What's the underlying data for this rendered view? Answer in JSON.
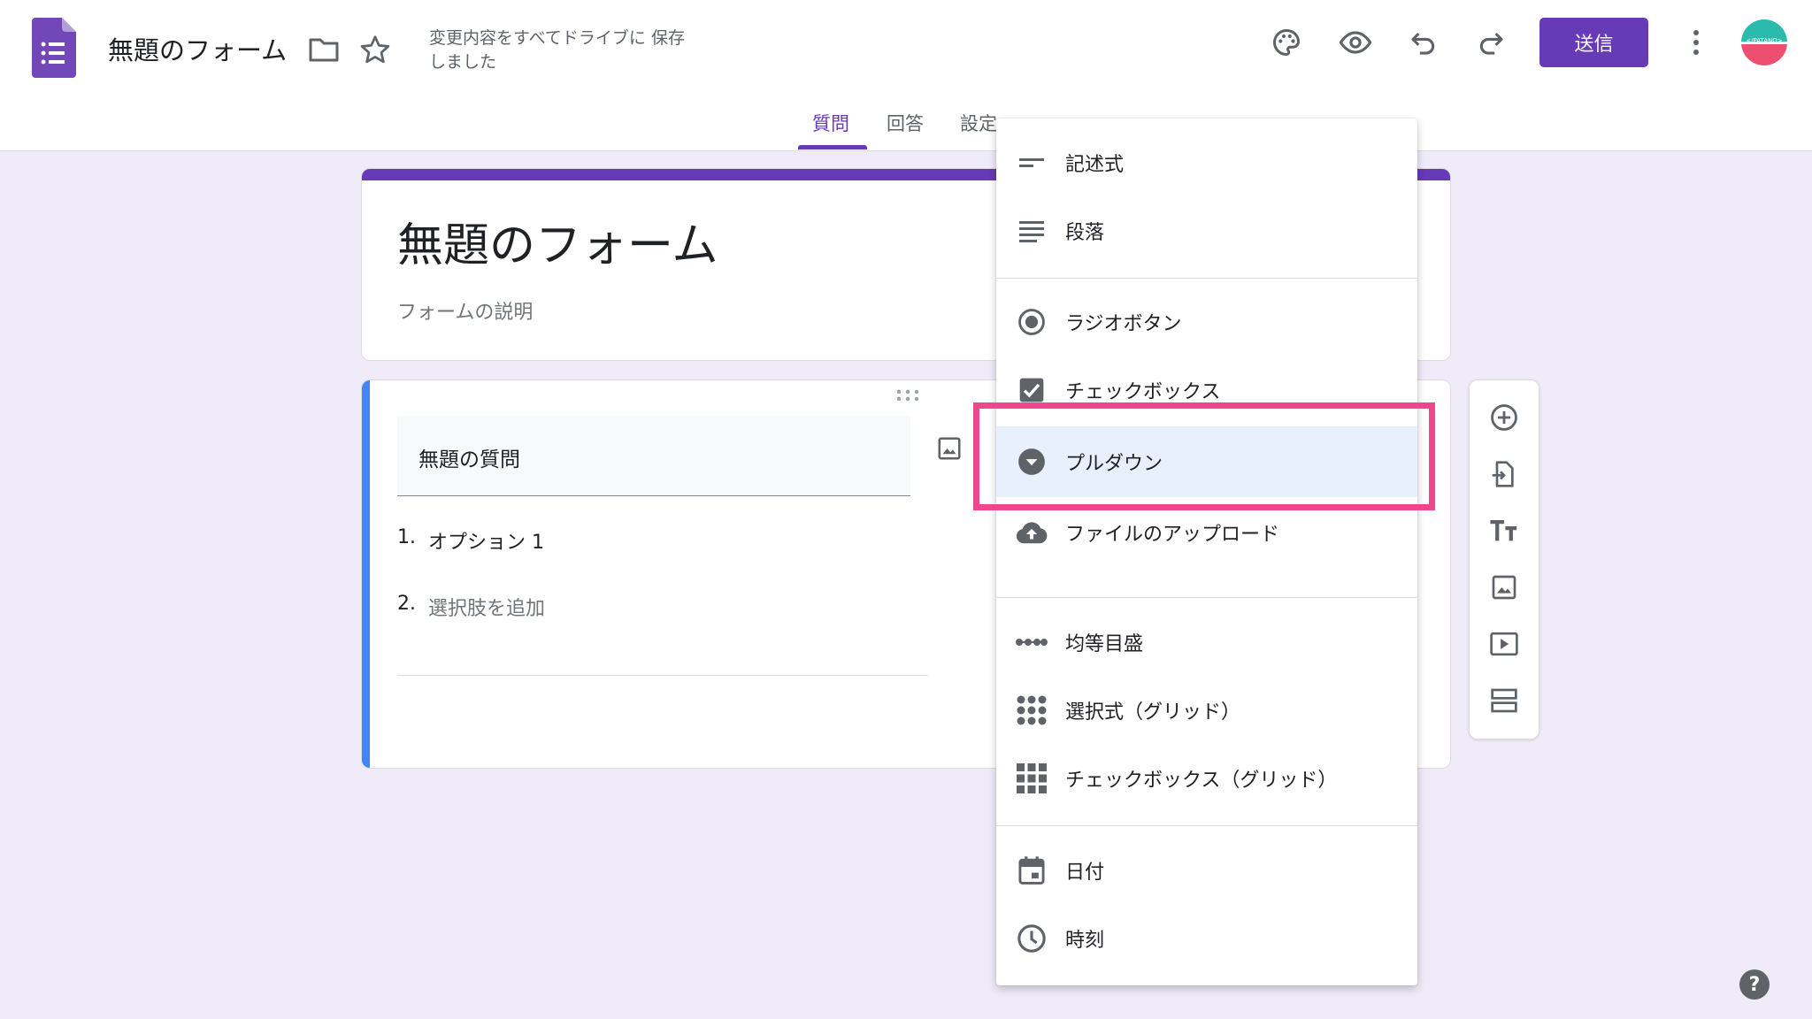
{
  "header": {
    "doc_title": "無題のフォーム",
    "save_status": "変更内容をすべてドライブに 保存しました",
    "send_label": "送信",
    "avatar_text": "</PATANO>",
    "icons": [
      "forms-logo-icon",
      "folder-icon",
      "star-icon",
      "palette-icon",
      "preview-eye-icon",
      "undo-icon",
      "redo-icon",
      "more-vert-icon"
    ]
  },
  "tabs": [
    {
      "label": "質問",
      "active": true
    },
    {
      "label": "回答",
      "active": false
    },
    {
      "label": "設定",
      "active": false
    }
  ],
  "form": {
    "title": "無題のフォーム",
    "description_placeholder": "フォームの説明"
  },
  "question": {
    "title": "無題の質問",
    "options": [
      {
        "num": "1.",
        "text": "オプション 1"
      },
      {
        "num": "2.",
        "text": "選択肢を追加"
      }
    ]
  },
  "question_type_menu": {
    "groups": [
      [
        {
          "label": "記述式",
          "icon": "short-answer-icon"
        },
        {
          "label": "段落",
          "icon": "paragraph-icon"
        }
      ],
      [
        {
          "label": "ラジオボタン",
          "icon": "radio-button-icon"
        },
        {
          "label": "チェックボックス",
          "icon": "checkbox-icon"
        },
        {
          "label": "プルダウン",
          "icon": "dropdown-icon",
          "highlighted": true
        },
        {
          "label": "ファイルのアップロード",
          "icon": "cloud-upload-icon"
        }
      ],
      [
        {
          "label": "均等目盛",
          "icon": "linear-scale-icon"
        },
        {
          "label": "選択式（グリッド）",
          "icon": "multiple-choice-grid-icon"
        },
        {
          "label": "チェックボックス（グリッド）",
          "icon": "checkbox-grid-icon"
        }
      ],
      [
        {
          "label": "日付",
          "icon": "calendar-icon"
        },
        {
          "label": "時刻",
          "icon": "clock-icon"
        }
      ]
    ]
  },
  "side_toolbar": [
    "add-question-icon",
    "import-questions-icon",
    "add-title-icon",
    "add-image-icon",
    "add-video-icon",
    "add-section-icon"
  ],
  "help_label": "?",
  "colors": {
    "accent": "#673ab7",
    "background": "#f0ebf8",
    "question_accent": "#4285f4",
    "highlight_box": "#f0478c",
    "menu_highlight": "#e8f0fe"
  }
}
